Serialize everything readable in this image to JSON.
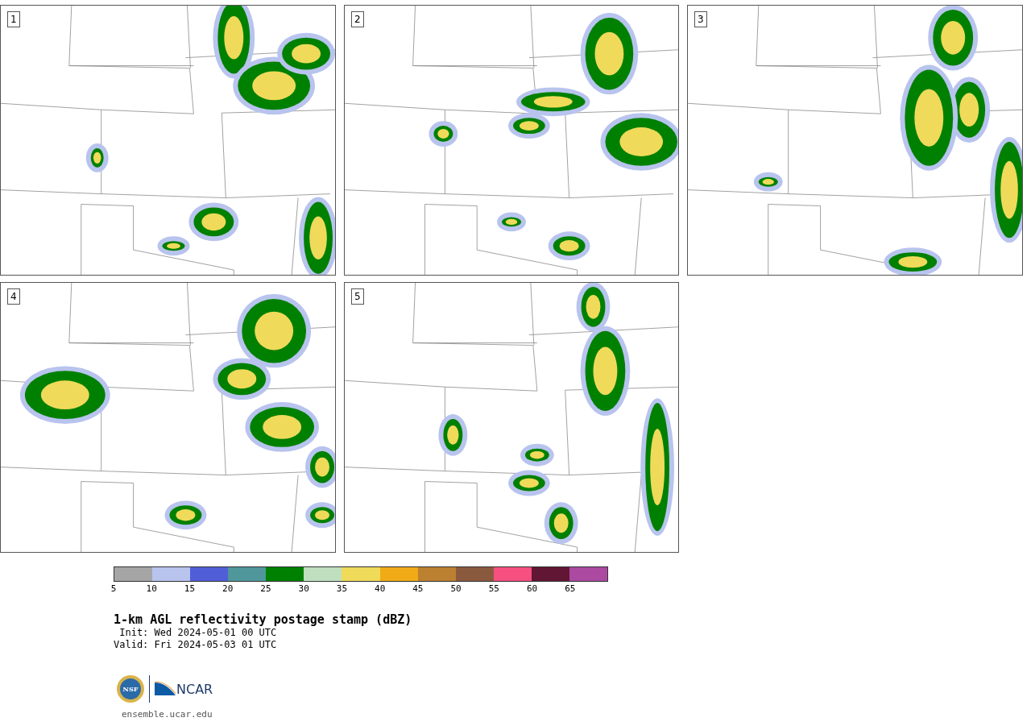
{
  "panels": [
    {
      "label": "1"
    },
    {
      "label": "2"
    },
    {
      "label": "3"
    },
    {
      "label": "4"
    },
    {
      "label": "5"
    }
  ],
  "colorbar": [
    {
      "label": "5",
      "color": "#a5a5a5"
    },
    {
      "label": "10",
      "color": "#b8c4ee"
    },
    {
      "label": "15",
      "color": "#505fd7"
    },
    {
      "label": "20",
      "color": "#4f979b"
    },
    {
      "label": "25",
      "color": "#008000"
    },
    {
      "label": "30",
      "color": "#bfdfbf"
    },
    {
      "label": "35",
      "color": "#f0da5a"
    },
    {
      "label": "40",
      "color": "#f0ab17"
    },
    {
      "label": "45",
      "color": "#bb8030"
    },
    {
      "label": "50",
      "color": "#8a5a3e"
    },
    {
      "label": "55",
      "color": "#f55080"
    },
    {
      "label": "60",
      "color": "#611634"
    },
    {
      "label": "65",
      "color": "#ab4aa0"
    }
  ],
  "title": "1-km AGL reflectivity postage stamp (dBZ)",
  "init": " Init: Wed 2024-05-01 00 UTC",
  "valid": "Valid: Fri 2024-05-03 01 UTC",
  "logos": {
    "nsf": "NSF",
    "ncar": "NCAR"
  },
  "footer": "ensemble.ucar.edu"
}
